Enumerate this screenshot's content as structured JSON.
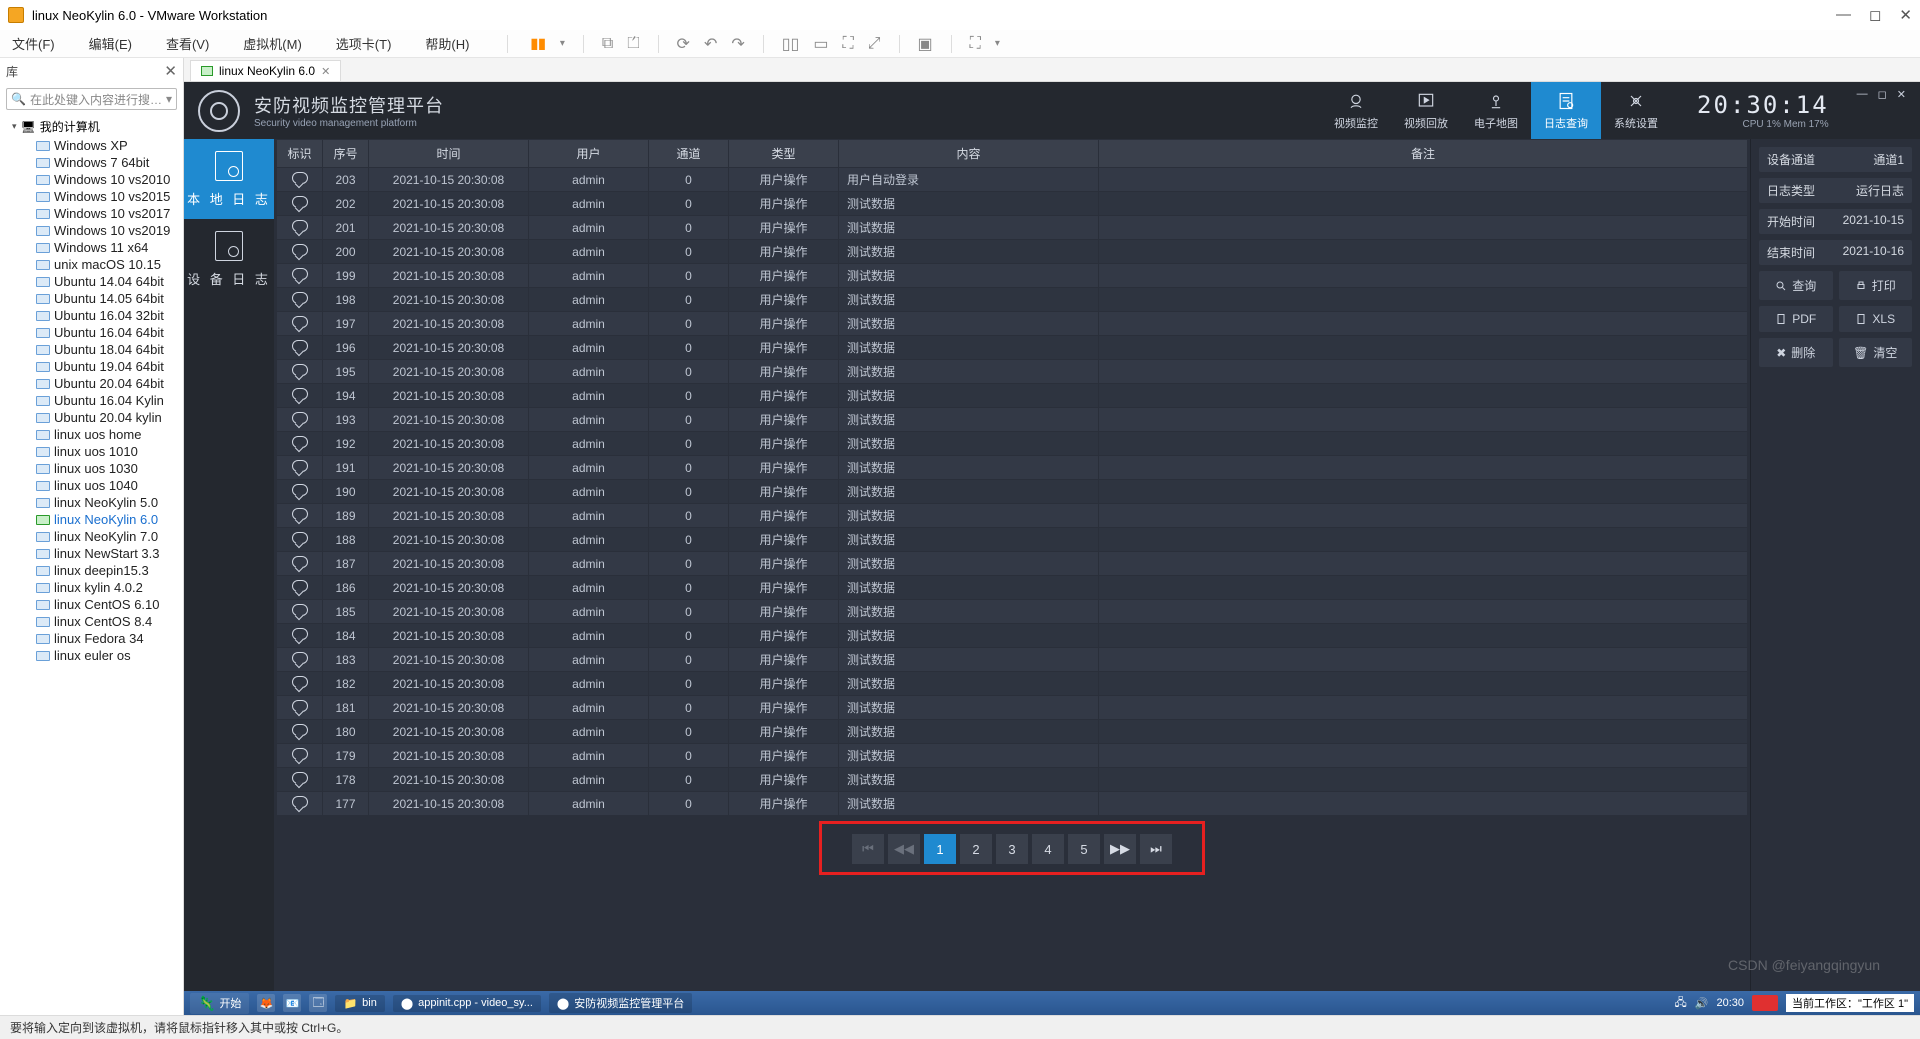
{
  "vmware": {
    "title": "linux NeoKylin 6.0 - VMware Workstation",
    "menus": [
      "文件(F)",
      "编辑(E)",
      "查看(V)",
      "虚拟机(M)",
      "选项卡(T)",
      "帮助(H)"
    ],
    "lib_title": "库",
    "search_ph": "在此处键入内容进行搜…",
    "root": "我的计算机",
    "vms": [
      "Windows XP",
      "Windows 7 64bit",
      "Windows 10 vs2010",
      "Windows 10 vs2015",
      "Windows 10 vs2017",
      "Windows 10 vs2019",
      "Windows 11 x64",
      "unix macOS 10.15",
      "Ubuntu 14.04 64bit",
      "Ubuntu 14.05 64bit",
      "Ubuntu 16.04 32bit",
      "Ubuntu 16.04 64bit",
      "Ubuntu 18.04 64bit",
      "Ubuntu 19.04 64bit",
      "Ubuntu 20.04 64bit",
      "Ubuntu 16.04 Kylin",
      "Ubuntu 20.04 kylin",
      "linux uos home",
      "linux uos 1010",
      "linux uos 1030",
      "linux uos 1040",
      "linux NeoKylin 5.0",
      "linux NeoKylin 6.0",
      "linux NeoKylin 7.0",
      "linux NewStart 3.3",
      "linux deepin15.3",
      "linux kylin 4.0.2",
      "linux CentOS 6.10",
      "linux CentOS 8.4",
      "linux Fedora 34",
      "linux euler os"
    ],
    "active_vm": "linux NeoKylin 6.0",
    "tab_label": "linux NeoKylin 6.0",
    "status": "要将输入定向到该虚拟机，请将鼠标指针移入其中或按 Ctrl+G。"
  },
  "app": {
    "title": "安防视频监控管理平台",
    "subtitle": "Security video management platform",
    "nav": {
      "video": "视频监控",
      "playback": "视频回放",
      "map": "电子地图",
      "log": "日志查询",
      "settings": "系统设置"
    },
    "time": "20:30:14",
    "cpu": "CPU 1%  Mem 17%",
    "side": {
      "local": "本 地 日 志",
      "device": "设 备 日 志"
    },
    "cols": [
      "标识",
      "序号",
      "时间",
      "用户",
      "通道",
      "类型",
      "内容",
      "备注"
    ],
    "rows": [
      {
        "seq": "203",
        "time": "2021-10-15 20:30:08",
        "user": "admin",
        "ch": "0",
        "type": "用户操作",
        "content": "用户自动登录",
        "note": ""
      },
      {
        "seq": "202",
        "time": "2021-10-15 20:30:08",
        "user": "admin",
        "ch": "0",
        "type": "用户操作",
        "content": "测试数据",
        "note": ""
      },
      {
        "seq": "201",
        "time": "2021-10-15 20:30:08",
        "user": "admin",
        "ch": "0",
        "type": "用户操作",
        "content": "测试数据",
        "note": ""
      },
      {
        "seq": "200",
        "time": "2021-10-15 20:30:08",
        "user": "admin",
        "ch": "0",
        "type": "用户操作",
        "content": "测试数据",
        "note": ""
      },
      {
        "seq": "199",
        "time": "2021-10-15 20:30:08",
        "user": "admin",
        "ch": "0",
        "type": "用户操作",
        "content": "测试数据",
        "note": ""
      },
      {
        "seq": "198",
        "time": "2021-10-15 20:30:08",
        "user": "admin",
        "ch": "0",
        "type": "用户操作",
        "content": "测试数据",
        "note": ""
      },
      {
        "seq": "197",
        "time": "2021-10-15 20:30:08",
        "user": "admin",
        "ch": "0",
        "type": "用户操作",
        "content": "测试数据",
        "note": ""
      },
      {
        "seq": "196",
        "time": "2021-10-15 20:30:08",
        "user": "admin",
        "ch": "0",
        "type": "用户操作",
        "content": "测试数据",
        "note": ""
      },
      {
        "seq": "195",
        "time": "2021-10-15 20:30:08",
        "user": "admin",
        "ch": "0",
        "type": "用户操作",
        "content": "测试数据",
        "note": ""
      },
      {
        "seq": "194",
        "time": "2021-10-15 20:30:08",
        "user": "admin",
        "ch": "0",
        "type": "用户操作",
        "content": "测试数据",
        "note": ""
      },
      {
        "seq": "193",
        "time": "2021-10-15 20:30:08",
        "user": "admin",
        "ch": "0",
        "type": "用户操作",
        "content": "测试数据",
        "note": ""
      },
      {
        "seq": "192",
        "time": "2021-10-15 20:30:08",
        "user": "admin",
        "ch": "0",
        "type": "用户操作",
        "content": "测试数据",
        "note": ""
      },
      {
        "seq": "191",
        "time": "2021-10-15 20:30:08",
        "user": "admin",
        "ch": "0",
        "type": "用户操作",
        "content": "测试数据",
        "note": ""
      },
      {
        "seq": "190",
        "time": "2021-10-15 20:30:08",
        "user": "admin",
        "ch": "0",
        "type": "用户操作",
        "content": "测试数据",
        "note": ""
      },
      {
        "seq": "189",
        "time": "2021-10-15 20:30:08",
        "user": "admin",
        "ch": "0",
        "type": "用户操作",
        "content": "测试数据",
        "note": ""
      },
      {
        "seq": "188",
        "time": "2021-10-15 20:30:08",
        "user": "admin",
        "ch": "0",
        "type": "用户操作",
        "content": "测试数据",
        "note": ""
      },
      {
        "seq": "187",
        "time": "2021-10-15 20:30:08",
        "user": "admin",
        "ch": "0",
        "type": "用户操作",
        "content": "测试数据",
        "note": ""
      },
      {
        "seq": "186",
        "time": "2021-10-15 20:30:08",
        "user": "admin",
        "ch": "0",
        "type": "用户操作",
        "content": "测试数据",
        "note": ""
      },
      {
        "seq": "185",
        "time": "2021-10-15 20:30:08",
        "user": "admin",
        "ch": "0",
        "type": "用户操作",
        "content": "测试数据",
        "note": ""
      },
      {
        "seq": "184",
        "time": "2021-10-15 20:30:08",
        "user": "admin",
        "ch": "0",
        "type": "用户操作",
        "content": "测试数据",
        "note": ""
      },
      {
        "seq": "183",
        "time": "2021-10-15 20:30:08",
        "user": "admin",
        "ch": "0",
        "type": "用户操作",
        "content": "测试数据",
        "note": ""
      },
      {
        "seq": "182",
        "time": "2021-10-15 20:30:08",
        "user": "admin",
        "ch": "0",
        "type": "用户操作",
        "content": "测试数据",
        "note": ""
      },
      {
        "seq": "181",
        "time": "2021-10-15 20:30:08",
        "user": "admin",
        "ch": "0",
        "type": "用户操作",
        "content": "测试数据",
        "note": ""
      },
      {
        "seq": "180",
        "time": "2021-10-15 20:30:08",
        "user": "admin",
        "ch": "0",
        "type": "用户操作",
        "content": "测试数据",
        "note": ""
      },
      {
        "seq": "179",
        "time": "2021-10-15 20:30:08",
        "user": "admin",
        "ch": "0",
        "type": "用户操作",
        "content": "测试数据",
        "note": ""
      },
      {
        "seq": "178",
        "time": "2021-10-15 20:30:08",
        "user": "admin",
        "ch": "0",
        "type": "用户操作",
        "content": "测试数据",
        "note": ""
      },
      {
        "seq": "177",
        "time": "2021-10-15 20:30:08",
        "user": "admin",
        "ch": "0",
        "type": "用户操作",
        "content": "测试数据",
        "note": ""
      }
    ],
    "pager": [
      "1",
      "2",
      "3",
      "4",
      "5"
    ],
    "panel": {
      "dev_ch_l": "设备通道",
      "dev_ch_v": "通道1",
      "log_t_l": "日志类型",
      "log_t_v": "运行日志",
      "start_l": "开始时间",
      "start_v": "2021-10-15",
      "end_l": "结束时间",
      "end_v": "2021-10-16",
      "query": "查询",
      "print": "打印",
      "pdf": "PDF",
      "xls": "XLS",
      "del": "删除",
      "clear": "清空"
    }
  },
  "taskbar": {
    "start": "开始",
    "bin": "bin",
    "app1": "appinit.cpp - video_sy...",
    "app2": "安防视频监控管理平台",
    "time": "20:30",
    "wk_label": "当前工作区：",
    "wk_val": "\"工作区 1\""
  },
  "watermark": "CSDN @feiyangqingyun"
}
